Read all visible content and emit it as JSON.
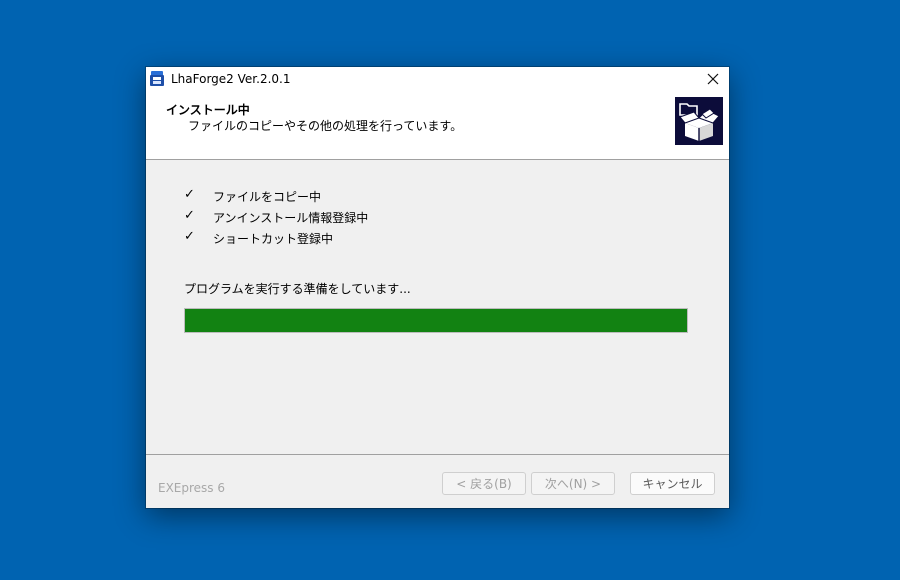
{
  "window": {
    "title": "LhaForge2 Ver.2.0.1"
  },
  "header": {
    "title": "インストール中",
    "subtitle": "ファイルのコピーやその他の処理を行っています。",
    "logo_icon": "open-box-icon"
  },
  "steps": [
    {
      "check": "✓",
      "label": "ファイルをコピー中"
    },
    {
      "check": "✓",
      "label": "アンインストール情報登録中"
    },
    {
      "check": "✓",
      "label": "ショートカット登録中"
    }
  ],
  "status": {
    "text": "プログラムを実行する準備をしています..."
  },
  "progress": {
    "value": 1.0,
    "color": "#128212"
  },
  "footer": {
    "brand": "EXEpress 6",
    "back_label": "< 戻る(B)",
    "next_label": "次へ(N) >",
    "cancel_label": "キャンセル"
  },
  "colors": {
    "desktop": "#0063b1",
    "dialog": "#f0f0f0"
  }
}
